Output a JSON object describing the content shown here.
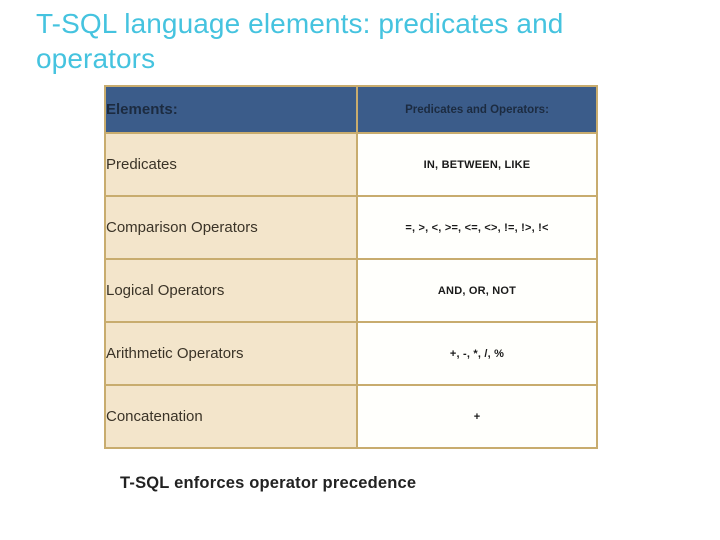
{
  "slide": {
    "title": "T-SQL language elements: predicates and operators",
    "title_color": "#45c3df",
    "background_color": "#ffffff",
    "footer_note": "T-SQL enforces operator precedence"
  },
  "table": {
    "header_background": "#3b5c8a",
    "header_text_color": "#1c2b40",
    "border_color": "#c8ac6e",
    "element_cell_background": "#f3e5cb",
    "operator_cell_background": "#fffffc",
    "headers": {
      "elements": "Elements:",
      "operators": "Predicates and Operators:"
    },
    "rows": [
      {
        "element": "Predicates",
        "operators": "IN, BETWEEN, LIKE"
      },
      {
        "element": "Comparison Operators",
        "operators": "=, >, <, >=, <=, <>, !=, !>, !<"
      },
      {
        "element": "Logical Operators",
        "operators": "AND, OR, NOT"
      },
      {
        "element": "Arithmetic Operators",
        "operators": "+, -, *, /, %"
      },
      {
        "element": "Concatenation",
        "operators": "+"
      }
    ]
  }
}
